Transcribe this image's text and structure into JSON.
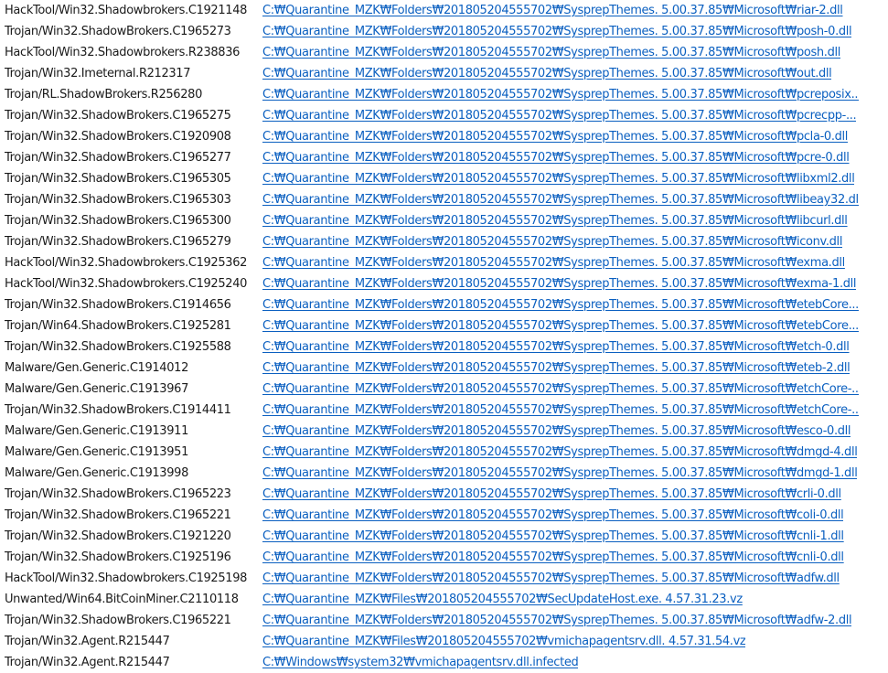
{
  "rows": [
    {
      "threat": "HackTool/Win32.Shadowbrokers.C1921148",
      "path": "C:₩Quarantine_MZK₩Folders₩201805204555702₩SysprepThemes. 5.00.37.85₩Microsoft₩riar-2.dll"
    },
    {
      "threat": "Trojan/Win32.ShadowBrokers.C1965273",
      "path": "C:₩Quarantine_MZK₩Folders₩201805204555702₩SysprepThemes. 5.00.37.85₩Microsoft₩posh-0.dll"
    },
    {
      "threat": "HackTool/Win32.Shadowbrokers.R238836",
      "path": "C:₩Quarantine_MZK₩Folders₩201805204555702₩SysprepThemes. 5.00.37.85₩Microsoft₩posh.dll"
    },
    {
      "threat": "Trojan/Win32.Imeternal.R212317",
      "path": "C:₩Quarantine_MZK₩Folders₩201805204555702₩SysprepThemes. 5.00.37.85₩Microsoft₩out.dll"
    },
    {
      "threat": "Trojan/RL.ShadowBrokers.R256280",
      "path": "C:₩Quarantine_MZK₩Folders₩201805204555702₩SysprepThemes. 5.00.37.85₩Microsoft₩pcreposix..."
    },
    {
      "threat": "Trojan/Win32.ShadowBrokers.C1965275",
      "path": "C:₩Quarantine_MZK₩Folders₩201805204555702₩SysprepThemes. 5.00.37.85₩Microsoft₩pcrecpp-..."
    },
    {
      "threat": "Trojan/Win32.ShadowBrokers.C1920908",
      "path": "C:₩Quarantine_MZK₩Folders₩201805204555702₩SysprepThemes. 5.00.37.85₩Microsoft₩pcla-0.dll"
    },
    {
      "threat": "Trojan/Win32.ShadowBrokers.C1965277",
      "path": "C:₩Quarantine_MZK₩Folders₩201805204555702₩SysprepThemes. 5.00.37.85₩Microsoft₩pcre-0.dll"
    },
    {
      "threat": "Trojan/Win32.ShadowBrokers.C1965305",
      "path": "C:₩Quarantine_MZK₩Folders₩201805204555702₩SysprepThemes. 5.00.37.85₩Microsoft₩libxml2.dll"
    },
    {
      "threat": "Trojan/Win32.ShadowBrokers.C1965303",
      "path": "C:₩Quarantine_MZK₩Folders₩201805204555702₩SysprepThemes. 5.00.37.85₩Microsoft₩libeay32.dll"
    },
    {
      "threat": "Trojan/Win32.ShadowBrokers.C1965300",
      "path": "C:₩Quarantine_MZK₩Folders₩201805204555702₩SysprepThemes. 5.00.37.85₩Microsoft₩libcurl.dll"
    },
    {
      "threat": "Trojan/Win32.ShadowBrokers.C1965279",
      "path": "C:₩Quarantine_MZK₩Folders₩201805204555702₩SysprepThemes. 5.00.37.85₩Microsoft₩iconv.dll"
    },
    {
      "threat": "HackTool/Win32.Shadowbrokers.C1925362",
      "path": "C:₩Quarantine_MZK₩Folders₩201805204555702₩SysprepThemes. 5.00.37.85₩Microsoft₩exma.dll"
    },
    {
      "threat": "HackTool/Win32.Shadowbrokers.C1925240",
      "path": "C:₩Quarantine_MZK₩Folders₩201805204555702₩SysprepThemes. 5.00.37.85₩Microsoft₩exma-1.dll"
    },
    {
      "threat": "Trojan/Win32.ShadowBrokers.C1914656",
      "path": "C:₩Quarantine_MZK₩Folders₩201805204555702₩SysprepThemes. 5.00.37.85₩Microsoft₩etebCore..."
    },
    {
      "threat": "Trojan/Win64.ShadowBrokers.C1925281",
      "path": "C:₩Quarantine_MZK₩Folders₩201805204555702₩SysprepThemes. 5.00.37.85₩Microsoft₩etebCore..."
    },
    {
      "threat": "Trojan/Win32.ShadowBrokers.C1925588",
      "path": "C:₩Quarantine_MZK₩Folders₩201805204555702₩SysprepThemes. 5.00.37.85₩Microsoft₩etch-0.dll"
    },
    {
      "threat": "Malware/Gen.Generic.C1914012",
      "path": "C:₩Quarantine_MZK₩Folders₩201805204555702₩SysprepThemes. 5.00.37.85₩Microsoft₩eteb-2.dll"
    },
    {
      "threat": "Malware/Gen.Generic.C1913967",
      "path": "C:₩Quarantine_MZK₩Folders₩201805204555702₩SysprepThemes. 5.00.37.85₩Microsoft₩etchCore-..."
    },
    {
      "threat": "Trojan/Win32.ShadowBrokers.C1914411",
      "path": "C:₩Quarantine_MZK₩Folders₩201805204555702₩SysprepThemes. 5.00.37.85₩Microsoft₩etchCore-..."
    },
    {
      "threat": "Malware/Gen.Generic.C1913911",
      "path": "C:₩Quarantine_MZK₩Folders₩201805204555702₩SysprepThemes. 5.00.37.85₩Microsoft₩esco-0.dll"
    },
    {
      "threat": "Malware/Gen.Generic.C1913951",
      "path": "C:₩Quarantine_MZK₩Folders₩201805204555702₩SysprepThemes. 5.00.37.85₩Microsoft₩dmgd-4.dll"
    },
    {
      "threat": "Malware/Gen.Generic.C1913998",
      "path": "C:₩Quarantine_MZK₩Folders₩201805204555702₩SysprepThemes. 5.00.37.85₩Microsoft₩dmgd-1.dll"
    },
    {
      "threat": "Trojan/Win32.ShadowBrokers.C1965223",
      "path": "C:₩Quarantine_MZK₩Folders₩201805204555702₩SysprepThemes. 5.00.37.85₩Microsoft₩crli-0.dll"
    },
    {
      "threat": "Trojan/Win32.ShadowBrokers.C1965221",
      "path": "C:₩Quarantine_MZK₩Folders₩201805204555702₩SysprepThemes. 5.00.37.85₩Microsoft₩coli-0.dll"
    },
    {
      "threat": "Trojan/Win32.ShadowBrokers.C1921220",
      "path": "C:₩Quarantine_MZK₩Folders₩201805204555702₩SysprepThemes. 5.00.37.85₩Microsoft₩cnli-1.dll"
    },
    {
      "threat": "Trojan/Win32.ShadowBrokers.C1925196",
      "path": "C:₩Quarantine_MZK₩Folders₩201805204555702₩SysprepThemes. 5.00.37.85₩Microsoft₩cnli-0.dll"
    },
    {
      "threat": "HackTool/Win32.Shadowbrokers.C1925198",
      "path": "C:₩Quarantine_MZK₩Folders₩201805204555702₩SysprepThemes. 5.00.37.85₩Microsoft₩adfw.dll"
    },
    {
      "threat": "Unwanted/Win64.BitCoinMiner.C2110118",
      "path": "C:₩Quarantine_MZK₩Files₩201805204555702₩SecUpdateHost.exe. 4.57.31.23.vz"
    },
    {
      "threat": "Trojan/Win32.ShadowBrokers.C1965221",
      "path": "C:₩Quarantine_MZK₩Folders₩201805204555702₩SysprepThemes. 5.00.37.85₩Microsoft₩adfw-2.dll"
    },
    {
      "threat": "Trojan/Win32.Agent.R215447",
      "path": "C:₩Quarantine_MZK₩Files₩201805204555702₩vmichapagentsrv.dll. 4.57.31.54.vz"
    },
    {
      "threat": "Trojan/Win32.Agent.R215447",
      "path": "C:₩Windows₩system32₩vmichapagentsrv.dll.infected"
    }
  ]
}
